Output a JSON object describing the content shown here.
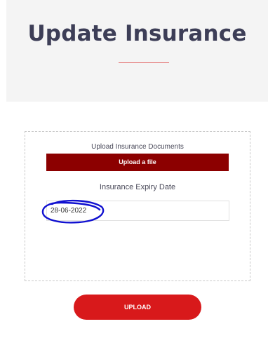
{
  "page": {
    "title": "Update Insurance"
  },
  "form": {
    "documents_label": "Upload Insurance Documents",
    "file_button_label": "Upload a file",
    "expiry_label": "Insurance Expiry Date",
    "expiry_value": "28-06-2022",
    "submit_label": "UPLOAD"
  },
  "colors": {
    "title": "#3d3e57",
    "accent_underline": "#e36a6a",
    "file_button": "#8c0000",
    "submit_button": "#d8191b",
    "annotation": "#1010d0"
  }
}
